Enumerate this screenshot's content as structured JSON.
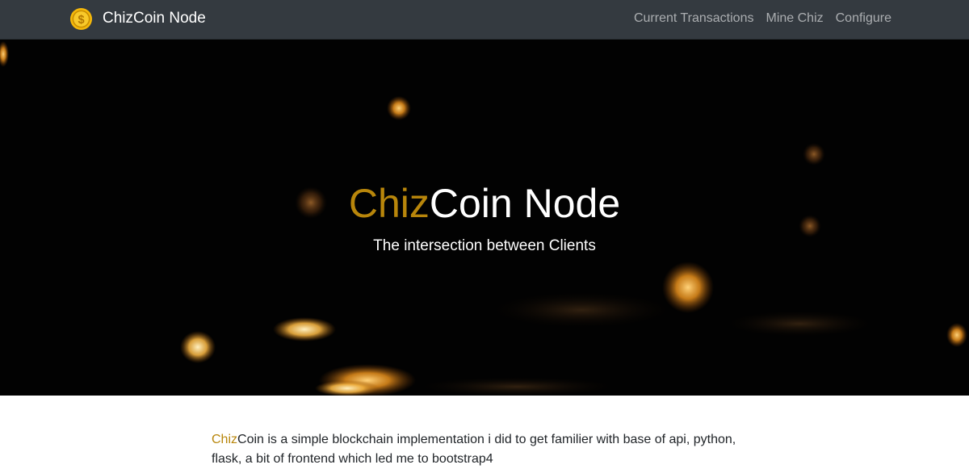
{
  "navbar": {
    "brand": "ChizCoin Node",
    "links": [
      {
        "label": "Current Transactions"
      },
      {
        "label": "Mine Chiz"
      },
      {
        "label": "Configure"
      }
    ]
  },
  "hero": {
    "title_accent": "Chiz",
    "title_rest": "Coin Node",
    "subtitle": "The intersection between Clients"
  },
  "content": {
    "intro_accent": "Chiz",
    "intro_rest": "Coin is a simple blockchain implementation i did to get familier with base of api, python, flask, a bit of frontend which led me to bootstrap4"
  },
  "colors": {
    "navbar_bg": "#343a40",
    "accent": "#b8860b",
    "hero_bg": "#020202"
  },
  "icons": {
    "brand": "gold-coin-dollar-icon"
  }
}
